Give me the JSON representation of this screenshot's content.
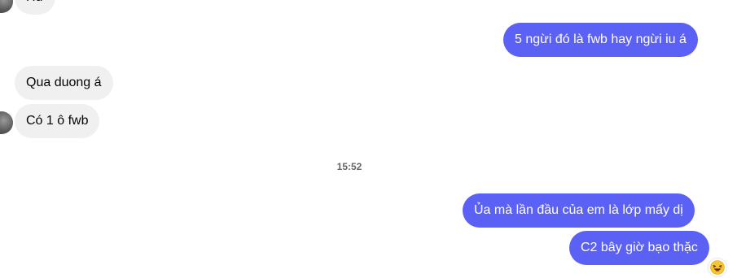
{
  "messages": [
    {
      "text": "Hứ",
      "direction": "incoming"
    },
    {
      "text": "5 ngừi đó là fwb hay ngừi iu á",
      "direction": "outgoing"
    },
    {
      "text": "Qua duong á",
      "direction": "incoming"
    },
    {
      "text": "Có 1 ô fwb",
      "direction": "incoming"
    },
    {
      "text": "Ủa mà lần đầu của em là lớp mấy dị",
      "direction": "outgoing"
    },
    {
      "text": "C2 bây giờ bạo thặc",
      "direction": "outgoing",
      "reaction": "laughing-face-emoji"
    }
  ],
  "timestamp": "15:52",
  "colors": {
    "outgoing_bubble": "#5b61f5",
    "incoming_bubble": "#f0f0f0",
    "timestamp_text": "#65676b"
  }
}
